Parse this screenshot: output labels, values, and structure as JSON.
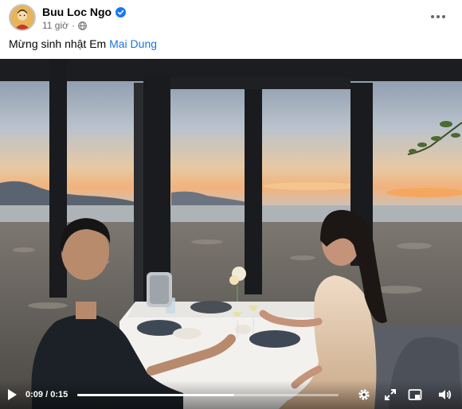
{
  "post": {
    "author": "Buu Loc Ngo",
    "timestamp": "11 giờ",
    "meta_separator": "·",
    "caption_prefix": "Mừng sinh nhật Em ",
    "caption_mention": "Mai Dung"
  },
  "icons": {
    "verified": "verified-badge-icon",
    "audience": "globe-icon",
    "more": "more-options-icon"
  },
  "video": {
    "current_time": "0:09",
    "duration": "0:15",
    "time_separator": " / ",
    "progress": 0.6,
    "accent": "#ffffff"
  },
  "colors": {
    "link": "#1b74e4",
    "verified": "#1877f2",
    "secondary_text": "#65676b"
  }
}
